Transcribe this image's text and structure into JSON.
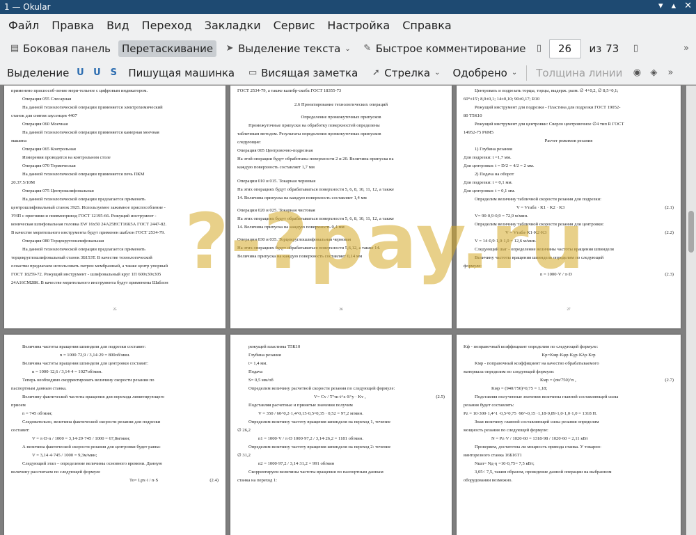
{
  "window": {
    "title": "1 — Okular"
  },
  "menu": [
    "Файл",
    "Правка",
    "Вид",
    "Переход",
    "Закладки",
    "Сервис",
    "Настройка",
    "Справка"
  ],
  "toolbar1": {
    "sidebar": "Боковая панель",
    "drag": "Перетаскивание",
    "text_select": "Выделение текста",
    "quick_comment": "Быстрое комментирование",
    "current_page": "26",
    "of_label": "из",
    "total_pages": "73"
  },
  "toolbar2": {
    "select": "Выделение",
    "typewriter": "Пишущая машинка",
    "sticky": "Висящая заметка",
    "arrow": "Стрелка",
    "approved": "Одобрено",
    "line_width": "Толщина линии"
  },
  "watermark": "?-?pay.ru",
  "pages": {
    "p25": [
      "применено приспособ-ление мери-тельное с цифровым индикатором.",
      "Операция 055 Слесарная",
      "На данной технологической операции применяется электрохимический",
      "станок для снятия заусенцев 4407",
      "Операция 060 Моечная",
      "На данной технологической операции применяется камерная моечная",
      "машина",
      "Операция 065 Контрольная",
      "Измерения проводятся на контрольном столе",
      "Операция 070 Термическая",
      "На данной технологической операции применяется печь ПКМ",
      "20.37.5/10М",
      "Операция 075 Центрошлифовальная",
      "На данной технологической операции предлагается применять",
      "центрошлифовальный станок 3925. Используемое зажимное приспособление -",
      "УНП с пригнями и пневмопривод ГОСТ 12195-66. Режущий инструмент -",
      "коническая шлифовальная головка EW 16x50 24А25НСТ16К5А ГОСТ 2447-82.",
      "В качестве мерительного инструмента будут применен шаблон ГОСТ 2534-79.",
      "Операция 080 Торцекруглошлифовальная",
      "На данной технологической операции предлагается применять",
      "торцекруглошлифовальный станок 3Б153Т. В качестве технологической",
      "оснастки предлагаем использовать патрон мембранный, а также центр упорный",
      "ГОСТ 18259-72. Режущий инструмент - шлифовальный круг 1П 600х30х305",
      "24А16СМ28К. В качестве мерительного инструмента будут применены Шаблон"
    ],
    "p25_num": "25",
    "p26": [
      "ГОСТ 2534-79, а также калибр-скоба ГОСТ 18355-73",
      "2.6 Проектирование технологических операций",
      "Определение промежуточных припусков",
      "Промежуточные припуски на обработку поверхностей определены",
      "табличным методом. Результаты определения промежуточных припусков",
      "следующие:",
      "Операция 005 Центровочно-подрезная",
      "На этой операции будут обработаны поверхности 2 и 20. Величина припуска на",
      "каждую поверхность составляет 1,7 мм",
      "Операции 010 и 015. Токарная черновая",
      "На этих операциях будут обрабатываться поверхности 5, 6, 8, 10, 11, 12, а также",
      "14. Величина припуска на каждую поверхность составляет 1,4 мм",
      "Операции 020 и 025. Токарная чистовая",
      "На этих операциях будут обрабатываться поверхности 5, 6, 8, 10, 11, 12, а также",
      "14. Величина припуска на каждую поверхность 0,4 мм",
      "Операции 030 и 035. Торцекруглошлифовальная черновая",
      "На этих операциях будут обрабатываться поверхности 5,6,12, а также 14.",
      "Величина припуска на каждую поверхность составляет 0,14 мм"
    ],
    "p26_num": "26",
    "p27": [
      "Центровать и подрезать торцы, торцы, выдерж. разм. ∅ 4+0,2, ∅ 8,5+0,1;",
      "60°±15'; 8,9±0,1; 14±0,10; 90±0,17; R10",
      "Режущий инструмент для подрезки - Пластина для подрезки ГОСТ 19052-",
      "80 Т5К10",
      "Режущий инструмент для центровки: Сверло центровочное ∅4 тип R ГОСТ",
      "14952-75 Р6М5",
      "Расчет режимов резания",
      "1) Глубина резания",
      "Для подрезки: t =1,7 мм.",
      "Для центровки: t = D/2 = 4/2 = 2 мм.",
      "2) Подача на оборот",
      "Для подрезки: t = 0,1 мм.",
      "Для центровки: t = 0,1 мм.",
      "Определим величину табличной скорости резания для подрезки:",
      "V = Vтабл · K1 · K2 · K3",
      "(2.1)",
      "V= 90·0,9·0,9 = 72,9 м/мин.",
      "Определим величину табличной скорости резания для центровки:",
      "V = Vтабл·K1·K2·K3",
      "(2.2)",
      "V = 14·0,9·1,0·1,0 = 12,6 м/мин.",
      "Следующий шаг - определение величины частоты вращения шпинделя",
      "Величину частоты вращения шпинделя определим по следующей",
      "формуле:",
      "n = 1000·V / π·D",
      "(2.3)"
    ],
    "p27_num": "27",
    "p28": [
      "Величина частоты вращения шпинделя для подрезки составит:",
      "n = 1000·72,9 / 3,14·29 = 800об/мин.",
      "Величина частоты вращения шпинделя для центровки составит:",
      "n = 1000·12,6 / 3,14·4 = 1027об/мин.",
      "Теперь необходимо скорректировать величину скорости резания по",
      "паспортным данным станка.",
      "Величину фактической частоты вращения для перехода лимитирующего",
      "приоем",
      "n = 745 об/мин;",
      "Следовательно, величина фактической скорости резании для подрезки",
      "составит:",
      "V = π·D·n / 1000 = 3,14·29·745 / 1000 = 67,8м/мин;",
      "А величина фактической скорости резания для центровки будет равна:",
      "V = 3,14·4·745 / 1000 = 9,3м/мин;",
      "Следующий этап – определение величины основного времени. Данную",
      "величину рассчитаем по следующей формуле",
      "To= Lpx·i / n·S",
      "(2.4)"
    ],
    "p29": [
      "режущей пластины Т5К10",
      "Глубина резания",
      "t= 1,4 мм.",
      "Подача",
      "S= 0,5 мм/об",
      "Определим величину расчетной скорости резания по следующей формуле:",
      "V= Cv / T^m·t^x·S^y · Kv ,",
      "(2.5)",
      "Подставляя расчетные и принятые значения получим",
      "V = 350 / 60^0,2·1,4^0,15·0,5^0,35 · 0,52 = 97,2 м/мин.",
      "Определим величину частоту вращения шпинделя на переход 1, точение",
      "∅ 26,2",
      "n1 = 1000·V / π·D  1000·97,2 / 3,14·26,2 = 1181 об/мин.",
      "Определим величину частоту вращения шпинделя на переход 2: точение",
      "∅ 31,2",
      "n2 = 1000·97,2 / 3,14·31,2 = 991 об/мин",
      "Скорректируем величины частоты вращения по паспортным данным",
      "станка на переход 1:"
    ],
    "p30": [
      "Kф - поправочный коэффициант определим по следующей формуле:",
      "Kp=Kмр·Kφр·Kγр·Kλр·Krр",
      "Kмр - поправочный коэффициент на качество обрабатываемого",
      "материала определим по следующей формуле:",
      "Kмр = (σв/750)^n ,",
      "(2.7)",
      "Kмр = (940/750)^0,75 = 1,18;",
      "Подставляя полученные значения величины главной составляющей силы",
      "резания будет составлять:",
      "Pz = 10·300·1,4^1 ·0,5^0,75 ·98^-0,15 ·1,18·0,89·1,0·1,0·1,0 = 1318 Н.",
      "Зная величину главной составляющей силы резания определим",
      "мощность резания по следующей формуле:",
      "N = Pz·V / 1020·60 = 1318·98 / 1020·60 = 2,11 кВт",
      "Проверяем, достаточна ли мощность привода станка. У токарно-",
      "винторезного станка 16Б16Т1",
      "Nшп= Nд·η =10·0,75= 7,5 кВт;",
      "3,05< 7,5, таким образом, проведение данной операции на выбранном",
      "оборудовании возможно."
    ]
  }
}
